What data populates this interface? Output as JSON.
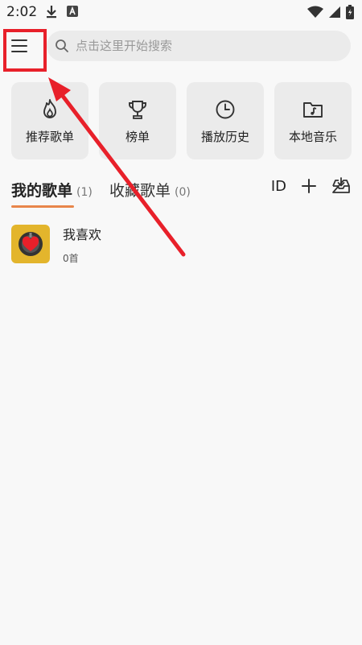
{
  "status_bar": {
    "time": "2:02"
  },
  "search": {
    "placeholder": "点击这里开始搜索",
    "value": ""
  },
  "shortcuts": [
    {
      "label": "推荐歌单",
      "icon": "flame-icon"
    },
    {
      "label": "榜单",
      "icon": "trophy-icon"
    },
    {
      "label": "播放历史",
      "icon": "clock-icon"
    },
    {
      "label": "本地音乐",
      "icon": "music-folder-icon"
    }
  ],
  "tabs": {
    "my_playlists": {
      "label": "我的歌单",
      "count": "(1)"
    },
    "favorite_playlists": {
      "label": "收藏歌单",
      "count": "(0)"
    }
  },
  "actions": {
    "id_label": "ID"
  },
  "playlists": [
    {
      "name": "我喜欢",
      "count": "0首"
    }
  ],
  "colors": {
    "accent": "#e8864a",
    "annotation": "#e8202a",
    "cover": "#e3b52c"
  }
}
